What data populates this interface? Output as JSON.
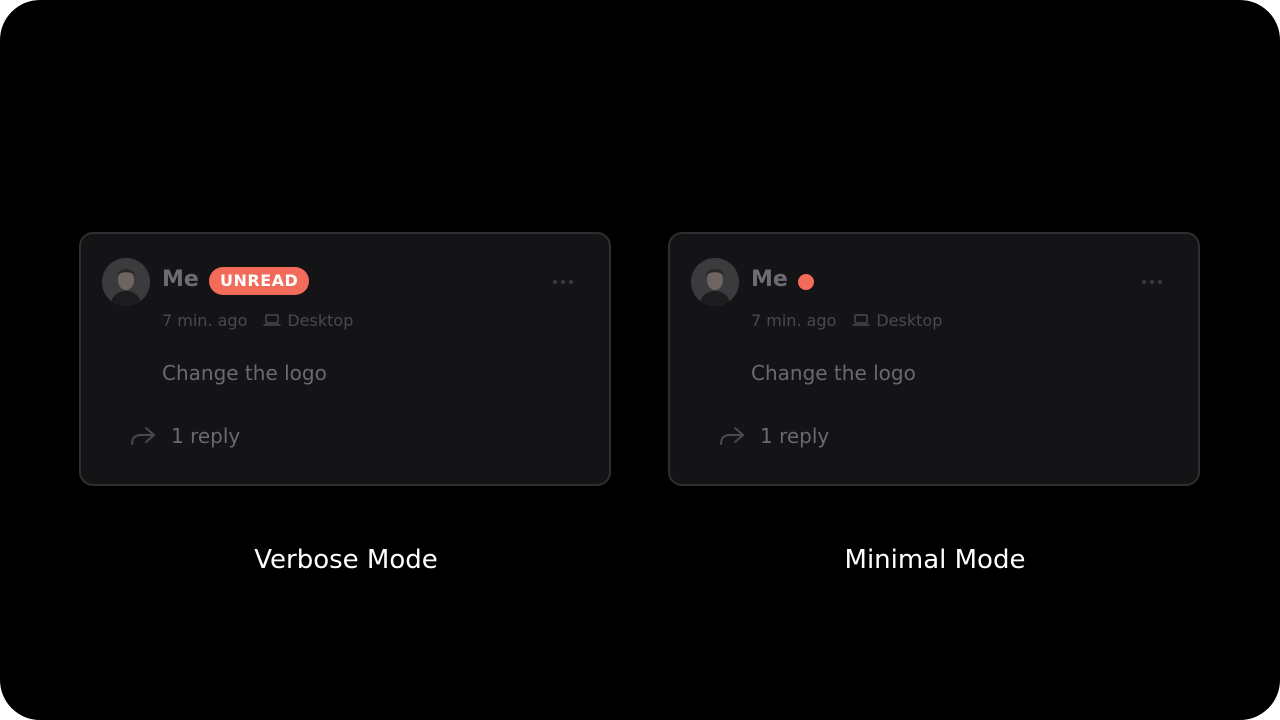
{
  "cards": [
    {
      "author": "Me",
      "status_badge": "UNREAD",
      "time": "7 min. ago",
      "device": "Desktop",
      "comment": "Change the logo",
      "replies": "1 reply"
    },
    {
      "author": "Me",
      "time": "7 min. ago",
      "device": "Desktop",
      "comment": "Change the logo",
      "replies": "1 reply"
    }
  ],
  "captions": {
    "left": "Verbose Mode",
    "right": "Minimal Mode"
  },
  "colors": {
    "background": "#000000",
    "card": "#141416",
    "card_border": "#2e2e31",
    "accent": "#f26b5b",
    "muted_text": "#6a6a6e"
  },
  "icons": [
    "avatar",
    "more-icon",
    "laptop-icon",
    "reply-icon",
    "unread-dot"
  ]
}
